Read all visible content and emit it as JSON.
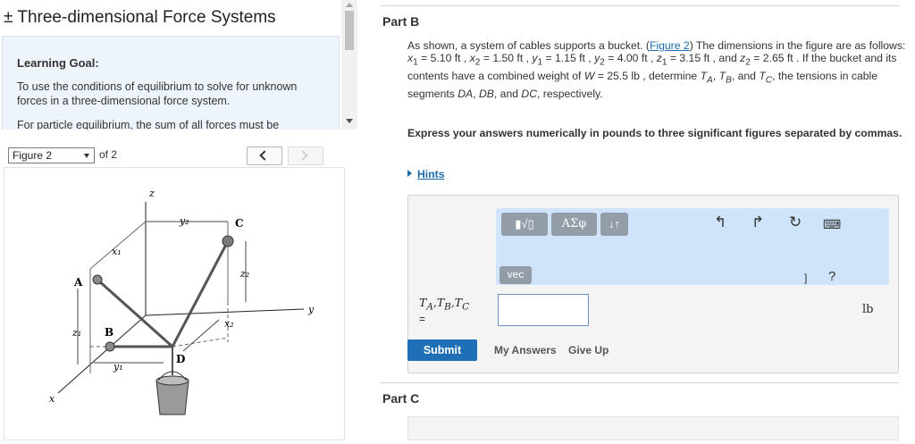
{
  "left": {
    "title": "± Three-dimensional Force Systems",
    "goal_heading": "Learning Goal:",
    "goal_text": "To use the conditions of equilibrium to solve for unknown forces in a three-dimensional force system.",
    "goal_text2": "For particle equilibrium, the sum of all forces must be"
  },
  "figure_nav": {
    "selected": "Figure 2",
    "of_label": "of 2",
    "prev_icon": "chevron-left-icon",
    "next_icon": "chevron-right-icon"
  },
  "figure": {
    "labels": {
      "z": "z",
      "y": "y",
      "x": "x",
      "y2": "y₂",
      "C": "C",
      "x1": "x₁",
      "A": "A",
      "z2": "z₂",
      "x2": "x₂",
      "z1": "z₁",
      "B": "B",
      "D": "D",
      "y1": "y₁"
    }
  },
  "partB": {
    "heading": "Part B",
    "problem_html": "As shown, a system of cables supports a bucket. (<a>Figure 2</a>) The dimensions in the figure are as follows: <i>x</i><sub>1</sub> = 5.10 ft , <i>x</i><sub>2</sub> = 1.50 ft , <i>y</i><sub>1</sub> = 1.15 ft , <i>y</i><sub>2</sub> = 4.00 ft , <i>z</i><sub>1</sub> = 3.15 ft , and <i>z</i><sub>2</sub> = 2.65 ft . If the bucket and its contents have a combined weight of <i>W</i> = 25.5 lb , determine <i>T<sub>A</sub></i>, <i>T<sub>B</sub></i>, and <i>T<sub>C</sub></i>, the tensions in cable segments <i>DA</i>, <i>DB</i>, and <i>DC</i>, respectively.",
    "express": "Express your answers numerically in pounds to three significant figures separated by commas.",
    "hints": "Hints",
    "toolbar": {
      "math_label": "▮√▯",
      "greek_label": "ΑΣφ",
      "arrows_label": "↓↑",
      "vec_label": "vec",
      "undo_icon": "undo-icon",
      "redo_icon": "redo-icon",
      "reset_icon": "reset-icon",
      "keyboard_icon": "keyboard-icon",
      "close_bracket": "]",
      "help_label": "?"
    },
    "variable_label": "TA,TB,TC",
    "equals": "=",
    "input_value": "",
    "unit": "lb",
    "submit": "Submit",
    "my_answers": "My Answers",
    "give_up": "Give Up"
  },
  "partC": {
    "heading": "Part C"
  },
  "colors": {
    "accent": "#1e6fb6",
    "toolbar_bg": "#cfe4fb",
    "goal_bg": "#eef4fb"
  }
}
